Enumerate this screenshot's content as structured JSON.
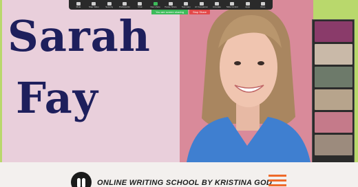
{
  "slide": {
    "name_first": "Sarah",
    "name_last": "Fay"
  },
  "toolbar": {
    "buttons": [
      {
        "label": "Mute",
        "icon": "microphone-icon"
      },
      {
        "label": "Stop Video",
        "icon": "video-camera-icon"
      },
      {
        "label": "Security",
        "icon": "shield-icon"
      },
      {
        "label": "Participants",
        "icon": "participants-icon"
      },
      {
        "label": "Chat",
        "icon": "chat-icon"
      },
      {
        "label": "New share",
        "icon": "share-screen-icon"
      },
      {
        "label": "Pause Share",
        "icon": "pause-icon"
      },
      {
        "label": "Summary",
        "icon": "summary-icon"
      },
      {
        "label": "AI Companion",
        "icon": "sparkle-icon"
      },
      {
        "label": "Annotate",
        "icon": "pen-icon"
      },
      {
        "label": "Slide Control",
        "icon": "slides-icon"
      },
      {
        "label": "Apps",
        "icon": "apps-icon"
      },
      {
        "label": "More",
        "icon": "more-icon"
      }
    ],
    "share_status": "You are screen sharing",
    "stop_share": "Stop Share"
  },
  "banner": {
    "text": "ONLINE WRITING SCHOOL BY KRISTINA GOD"
  },
  "colors": {
    "title_navy": "#1e1f5c",
    "pink_panel": "#e9cfdb",
    "accent_orange": "#ee6a2a",
    "share_green": "#3dbb5a",
    "stop_red": "#e34848"
  }
}
